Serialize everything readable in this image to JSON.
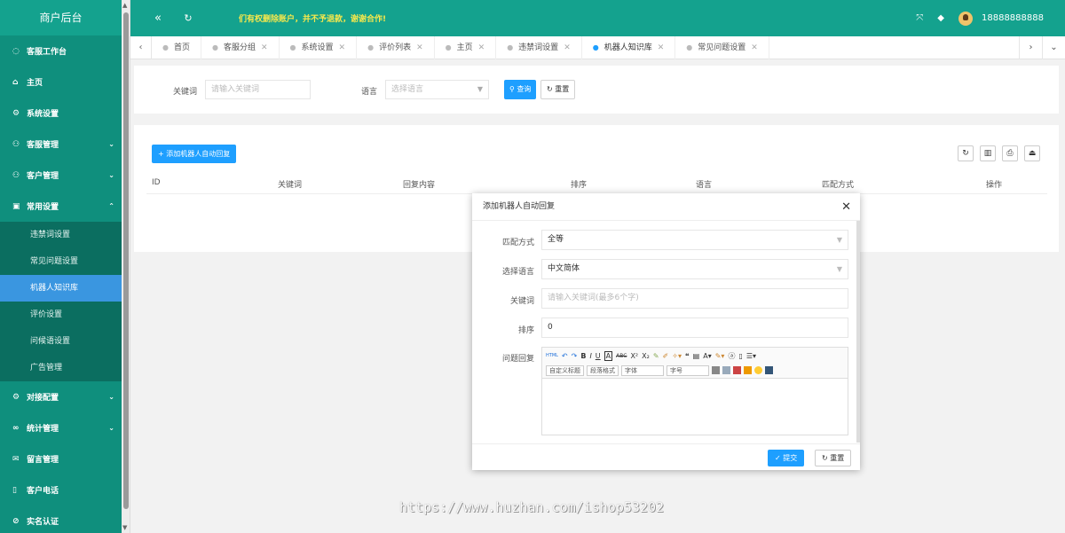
{
  "sidebar": {
    "title": "商户后台",
    "items": [
      {
        "icon": "◌",
        "label": "客服工作台",
        "arrow": ""
      },
      {
        "icon": "⌂",
        "label": "主页",
        "arrow": ""
      },
      {
        "icon": "⚙",
        "label": "系统设置",
        "arrow": ""
      },
      {
        "icon": "⚇",
        "label": "客服管理",
        "arrow": "⌄"
      },
      {
        "icon": "⚇",
        "label": "客户管理",
        "arrow": "⌄"
      },
      {
        "icon": "▣",
        "label": "常用设置",
        "arrow": "⌃"
      }
    ],
    "subitems": [
      {
        "label": "违禁词设置"
      },
      {
        "label": "常见问题设置"
      },
      {
        "label": "机器人知识库"
      },
      {
        "label": "评价设置"
      },
      {
        "label": "问候语设置"
      },
      {
        "label": "广告管理"
      }
    ],
    "items2": [
      {
        "icon": "⚙",
        "label": "对接配置",
        "arrow": "⌄"
      },
      {
        "icon": "∞",
        "label": "统计管理",
        "arrow": "⌄"
      },
      {
        "icon": "✉",
        "label": "留言管理",
        "arrow": ""
      },
      {
        "icon": "▯",
        "label": "客户电话",
        "arrow": ""
      },
      {
        "icon": "⊘",
        "label": "实名认证",
        "arrow": ""
      }
    ]
  },
  "header": {
    "collapse_icon": "«",
    "refresh_icon": "↻",
    "notice": "们有权删除账户，并不予退款，谢谢合作!",
    "phone": "18888888888"
  },
  "tabs": [
    {
      "label": "首页",
      "closable": false
    },
    {
      "label": "客服分组",
      "closable": true
    },
    {
      "label": "系统设置",
      "closable": true
    },
    {
      "label": "评价列表",
      "closable": true
    },
    {
      "label": "主页",
      "closable": true
    },
    {
      "label": "违禁词设置",
      "closable": true
    },
    {
      "label": "机器人知识库",
      "closable": true
    },
    {
      "label": "常见问题设置",
      "closable": true
    }
  ],
  "search": {
    "keyword_label": "关键词",
    "keyword_placeholder": "请输入关键词",
    "lang_label": "语言",
    "lang_placeholder": "选择语言",
    "query_btn": "查询",
    "reset_btn": "重置"
  },
  "table": {
    "add_btn": "+ 添加机器人自动回复",
    "headers": [
      "ID",
      "关键词",
      "回复内容",
      "排序",
      "语言",
      "匹配方式",
      "操作"
    ]
  },
  "modal": {
    "title": "添加机器人自动回复",
    "match_label": "匹配方式",
    "match_value": "全等",
    "lang_label": "选择语言",
    "lang_value": "中文简体",
    "keyword_label": "关键词",
    "keyword_placeholder": "请输入关键词(最多6个字)",
    "sort_label": "排序",
    "sort_value": "0",
    "reply_label": "问题回复",
    "editor_selects": [
      "自定义标题",
      "段落格式",
      "字体",
      "字号"
    ],
    "submit_btn": "提交",
    "reset_btn": "重置"
  },
  "watermark": "https://www.huzhan.com/ishop53202"
}
